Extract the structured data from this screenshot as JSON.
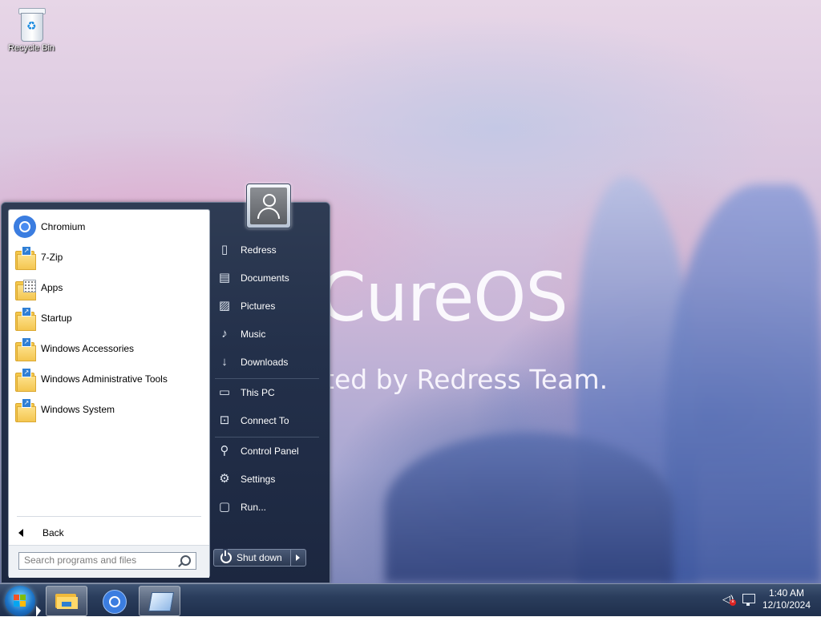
{
  "desktop": {
    "icons": [
      {
        "label": "Recycle Bin",
        "icon": "recycle-bin-icon"
      }
    ],
    "wallpaper_text": {
      "title": "CureOS",
      "subtitle": "ted by Redress Team."
    }
  },
  "start_menu": {
    "programs": [
      {
        "label": "Chromium",
        "icon": "chromium-icon"
      },
      {
        "label": "7-Zip",
        "icon": "folder-shortcut-icon"
      },
      {
        "label": "Apps",
        "icon": "apps-folder-icon"
      },
      {
        "label": "Startup",
        "icon": "folder-shortcut-icon"
      },
      {
        "label": "Windows Accessories",
        "icon": "folder-shortcut-icon"
      },
      {
        "label": "Windows Administrative Tools",
        "icon": "folder-shortcut-icon"
      },
      {
        "label": "Windows System",
        "icon": "folder-shortcut-icon"
      }
    ],
    "back_label": "Back",
    "search": {
      "placeholder": "Search programs and files",
      "value": ""
    },
    "right_items": [
      {
        "label": "Redress",
        "icon": "user-folder-icon"
      },
      {
        "label": "Documents",
        "icon": "documents-icon"
      },
      {
        "label": "Pictures",
        "icon": "pictures-icon"
      },
      {
        "label": "Music",
        "icon": "music-icon"
      },
      {
        "label": "Downloads",
        "icon": "downloads-icon"
      },
      {
        "label": "This PC",
        "icon": "computer-icon"
      },
      {
        "label": "Connect To",
        "icon": "connect-icon"
      },
      {
        "label": "Control Panel",
        "icon": "control-panel-icon"
      },
      {
        "label": "Settings",
        "icon": "settings-gear-icon"
      },
      {
        "label": "Run...",
        "icon": "run-icon"
      }
    ],
    "shutdown_label": "Shut down"
  },
  "taskbar": {
    "pinned": [
      {
        "name": "file-explorer",
        "icon": "folder-icon",
        "active": true
      },
      {
        "name": "chromium",
        "icon": "chromium-icon",
        "active": false
      },
      {
        "name": "app",
        "icon": "app-window-icon",
        "active": true
      }
    ],
    "tray": {
      "volume": "muted",
      "network": "network-icon"
    },
    "clock": {
      "time": "1:40 AM",
      "date": "12/10/2024"
    }
  },
  "colors": {
    "start_menu_bg": "#23304a",
    "taskbar_bg": "#2a3d5c",
    "accent": "#3b7de0"
  }
}
